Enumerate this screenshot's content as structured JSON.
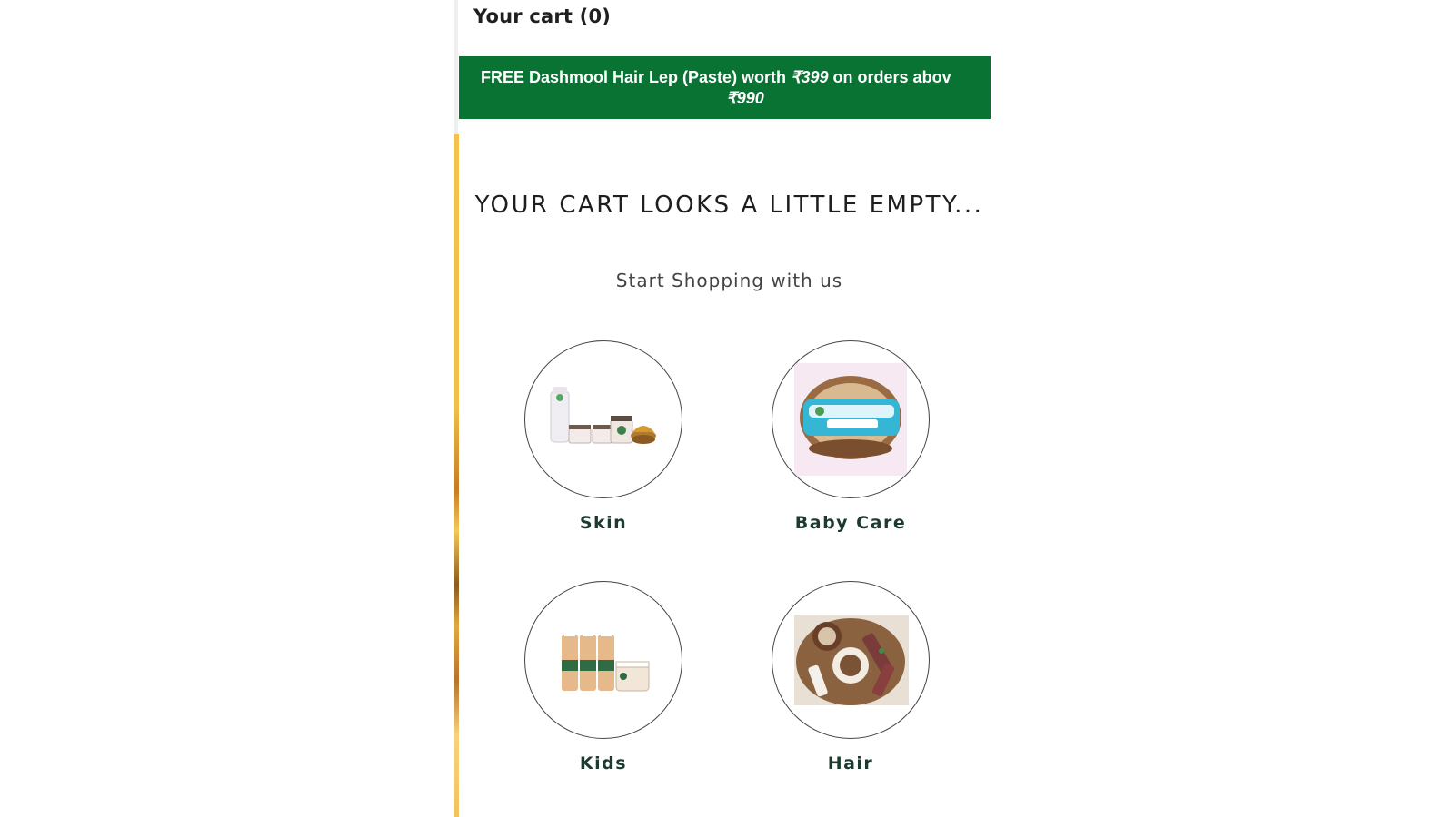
{
  "cart": {
    "title": "Your cart (0)"
  },
  "promo": {
    "line1_prefix": "FREE Dashmool Hair Lep (Paste) worth ",
    "line1_price": "₹399",
    "line1_suffix": " on orders abov",
    "line2": "₹990"
  },
  "empty_state": {
    "heading": "YOUR CART LOOKS A LITTLE EMPTY...",
    "subheading": "Start Shopping with us"
  },
  "categories": [
    {
      "label": "Skin",
      "icon": "skin-products-image"
    },
    {
      "label": "Baby Care",
      "icon": "baby-wipes-image"
    },
    {
      "label": "Kids",
      "icon": "kids-products-image"
    },
    {
      "label": "Hair",
      "icon": "hair-products-image"
    }
  ],
  "colors": {
    "promo_bg": "#087333",
    "label_text": "#1d3a2e"
  }
}
